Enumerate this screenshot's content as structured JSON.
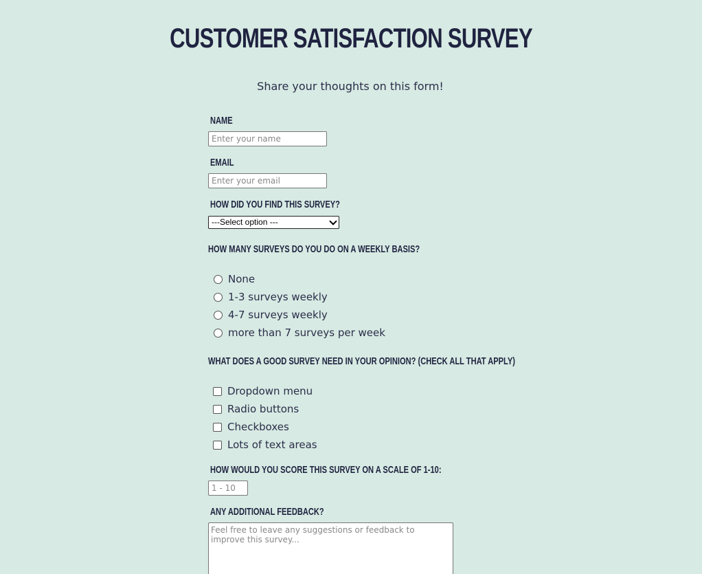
{
  "header": {
    "title": "Customer Satisfaction Survey",
    "subtitle": "Share your thoughts on this form!"
  },
  "form": {
    "name": {
      "label": "Name",
      "placeholder": "Enter your name"
    },
    "email": {
      "label": "Email",
      "placeholder": "Enter your email"
    },
    "source": {
      "label": "How did you find this survey?",
      "selected": "---Select option ---"
    },
    "frequency": {
      "label": "How many surveys do you do on a weekly basis?",
      "options": [
        "None",
        "1-3 surveys weekly",
        "4-7 surveys weekly",
        "more than 7 surveys per week"
      ]
    },
    "needs": {
      "label": "What does a good survey need in your opinion? (Check all that apply)",
      "options": [
        "Dropdown menu",
        "Radio buttons",
        "Checkboxes",
        "Lots of text areas"
      ]
    },
    "score": {
      "label": "How would you score this survey on a scale of 1-10:",
      "placeholder": "1 - 10"
    },
    "feedback": {
      "label": "Any additional feedback?",
      "placeholder": "Feel free to leave any suggestions or feedback to improve this survey..."
    }
  }
}
